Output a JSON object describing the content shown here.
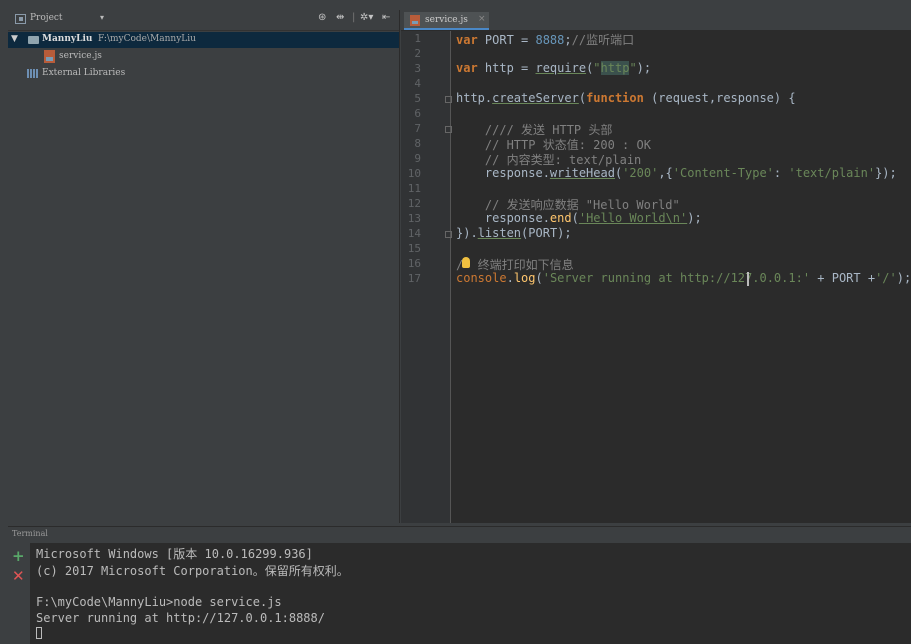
{
  "project": {
    "title": "Project",
    "dropdown": "▾",
    "toolbar_icons": [
      "crosshair-icon",
      "collapse-all-icon",
      "gear-icon",
      "hide-icon"
    ],
    "root_name": "MannyLiu",
    "root_path": "F:\\myCode\\MannyLiu",
    "file_name": "service.js",
    "external_libraries": "External Libraries"
  },
  "editor": {
    "tab_label": "service.js",
    "tab_close": "×",
    "line_numbers": [
      "1",
      "2",
      "3",
      "4",
      "5",
      "6",
      "7",
      "8",
      "9",
      "10",
      "11",
      "12",
      "13",
      "14",
      "15",
      "16",
      "17"
    ]
  },
  "terminal": {
    "header": "Terminal",
    "new_icon": "+",
    "close_icon": "✕",
    "lines": [
      "Microsoft Windows [版本 10.0.16299.936]",
      "(c) 2017 Microsoft Corporation。保留所有权利。",
      "",
      "F:\\myCode\\MannyLiu>node service.js",
      "Server running at http://127.0.0.1:8888/"
    ]
  },
  "colors": {
    "keyword": "#cc7832",
    "number": "#6897bb",
    "string": "#6a8759",
    "comment": "#808080",
    "function": "#ffc66d",
    "selection": "#0d293e",
    "tab_accent": "#4a88c7"
  }
}
